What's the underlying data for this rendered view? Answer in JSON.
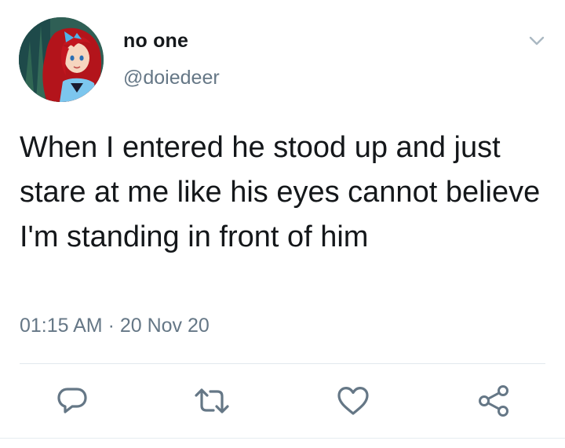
{
  "tweet": {
    "display_name": "no one",
    "handle": "@doiedeer",
    "text": "When I entered he stood up and just stare at me like his eyes cannot believe I'm standing in front of him",
    "timestamp": "01:15 AM · 20 Nov 20"
  },
  "icons": {
    "menu": "chevron-down-icon",
    "reply": "reply-icon",
    "retweet": "retweet-icon",
    "like": "heart-icon",
    "share": "share-icon"
  },
  "colors": {
    "text_primary": "#14171a",
    "text_secondary": "#657786",
    "icon": "#657786",
    "divider": "#e1e8ed"
  }
}
